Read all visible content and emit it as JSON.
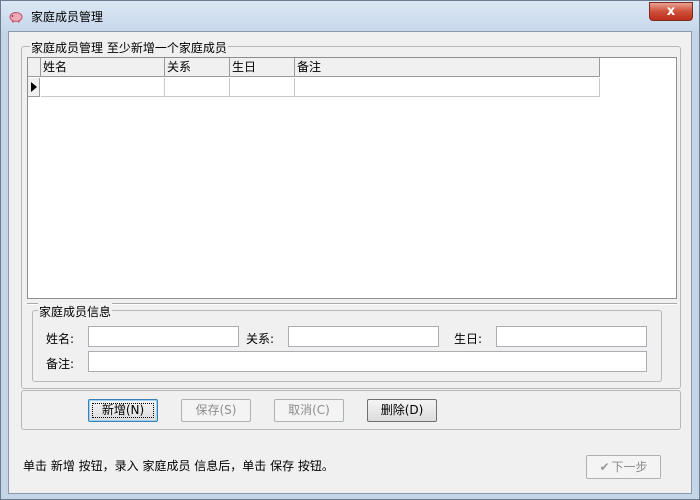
{
  "window": {
    "title": "家庭成员管理",
    "close_label": "x"
  },
  "group_list": {
    "title": "家庭成员管理 至少新增一个家庭成员",
    "columns": [
      "姓名",
      "关系",
      "生日",
      "备注"
    ]
  },
  "group_info": {
    "title": "家庭成员信息",
    "name_label": "姓名:",
    "relation_label": "关系:",
    "birthday_label": "生日:",
    "remark_label": "备注:",
    "name_value": "",
    "relation_value": "",
    "birthday_value": "",
    "remark_value": ""
  },
  "buttons": {
    "add": "新增(N)",
    "save": "保存(S)",
    "cancel": "取消(C)",
    "delete": "删除(D)"
  },
  "status_text": "单击 新增 按钮，录入 家庭成员 信息后，单击 保存 按钮。",
  "next_button": "下一步",
  "icons": {
    "app": "piggy-bank-icon",
    "next": "check-icon"
  }
}
